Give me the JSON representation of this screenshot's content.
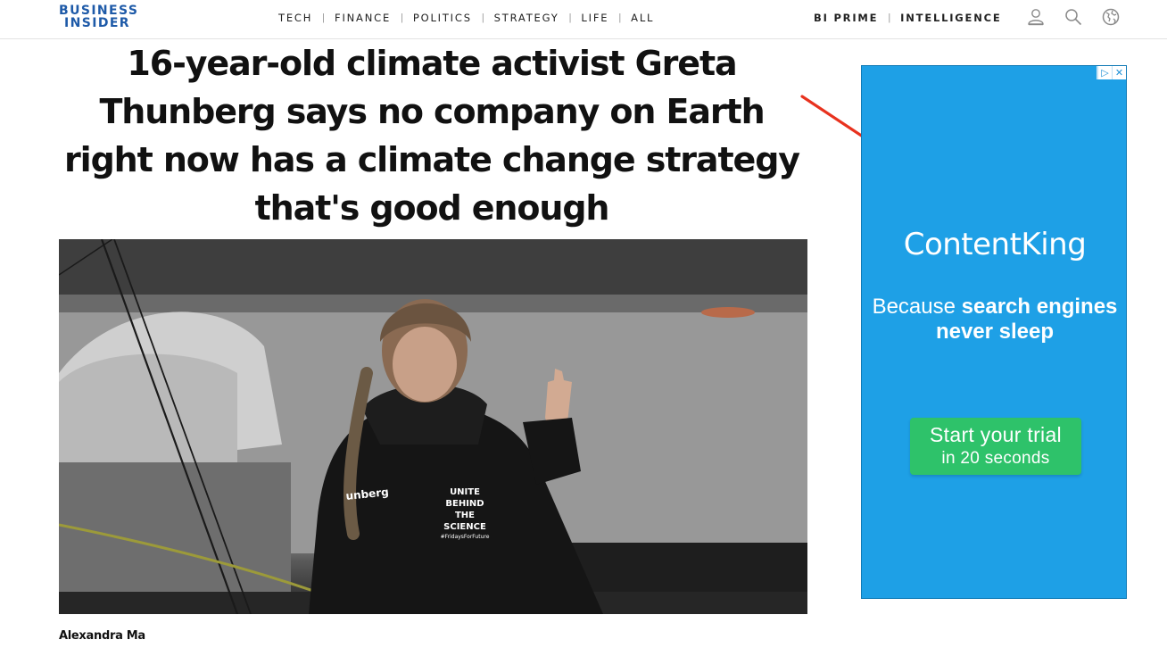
{
  "logo": {
    "line1": "BUSINESS",
    "line2": "INSIDER"
  },
  "nav": {
    "items": [
      "TECH",
      "FINANCE",
      "POLITICS",
      "STRATEGY",
      "LIFE",
      "ALL"
    ],
    "separator": "|",
    "right_items": [
      "BI PRIME",
      "INTELLIGENCE"
    ]
  },
  "header_icons": [
    "user-icon",
    "search-icon",
    "globe-icon"
  ],
  "article": {
    "headline": "16-year-old climate activist Greta Thunberg says no company on Earth right now has a climate change strategy that's good enough",
    "photo_text": {
      "jacket_name": "unberg",
      "shirt_line1": "UNITE",
      "shirt_line2": "BEHIND",
      "shirt_line3": "THE",
      "shirt_line4": "SCIENCE",
      "shirt_line5": "#FridaysForFuture"
    },
    "byline": "Alexandra Ma"
  },
  "ad": {
    "choices_icon": "ad-choices-icon",
    "close_icon": "close-icon",
    "brand": "ContentKing",
    "tagline_pre": "Because ",
    "tagline_bold": "search engines never sleep",
    "cta_line1": "Start your trial",
    "cta_line2": "in 20 seconds",
    "background_color": "#1ea0e6",
    "cta_color": "#2ec26a"
  },
  "annotation": {
    "arrow_color": "#e8321e"
  }
}
